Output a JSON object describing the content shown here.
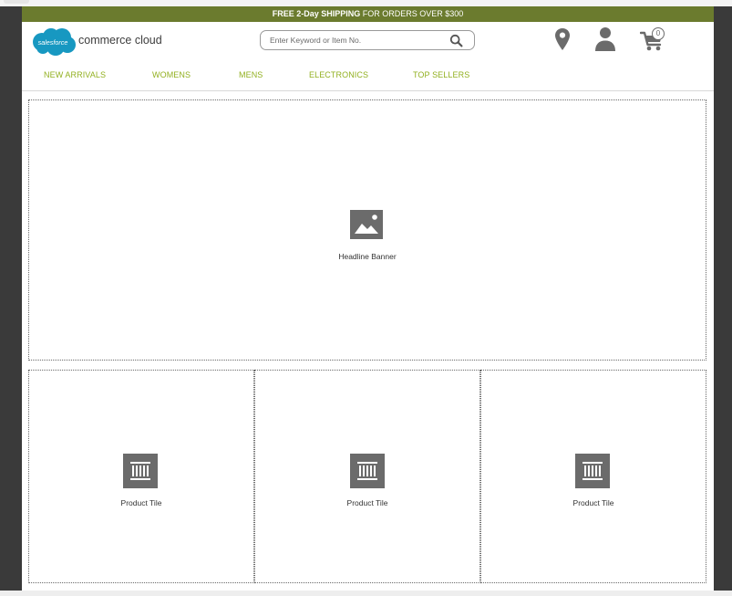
{
  "promo": {
    "bold": "FREE 2-Day SHIPPING",
    "rest": " FOR ORDERS OVER $300"
  },
  "brand": {
    "cloud_text": "salesforce",
    "name": "commerce cloud",
    "cloud_color": "#1798c1"
  },
  "search": {
    "placeholder": "Enter Keyword or Item No."
  },
  "cart": {
    "count": "0"
  },
  "nav": {
    "items": [
      "NEW ARRIVALS",
      "WOMENS",
      "MENS",
      "ELECTRONICS",
      "TOP SELLERS"
    ],
    "color": "#92b020"
  },
  "content": {
    "banner_label": "Headline Banner",
    "product_tiles": [
      "Product Tile",
      "Product Tile",
      "Product Tile"
    ]
  },
  "colors": {
    "promo_bar": "#6b7b2e",
    "icon_gray": "#6b6b6b"
  },
  "icons": {
    "search": "magnifier-icon",
    "location": "map-pin-icon",
    "account": "user-icon",
    "cart": "shopping-cart-icon",
    "banner": "image-placeholder-icon",
    "tile": "product-tile-icon"
  }
}
